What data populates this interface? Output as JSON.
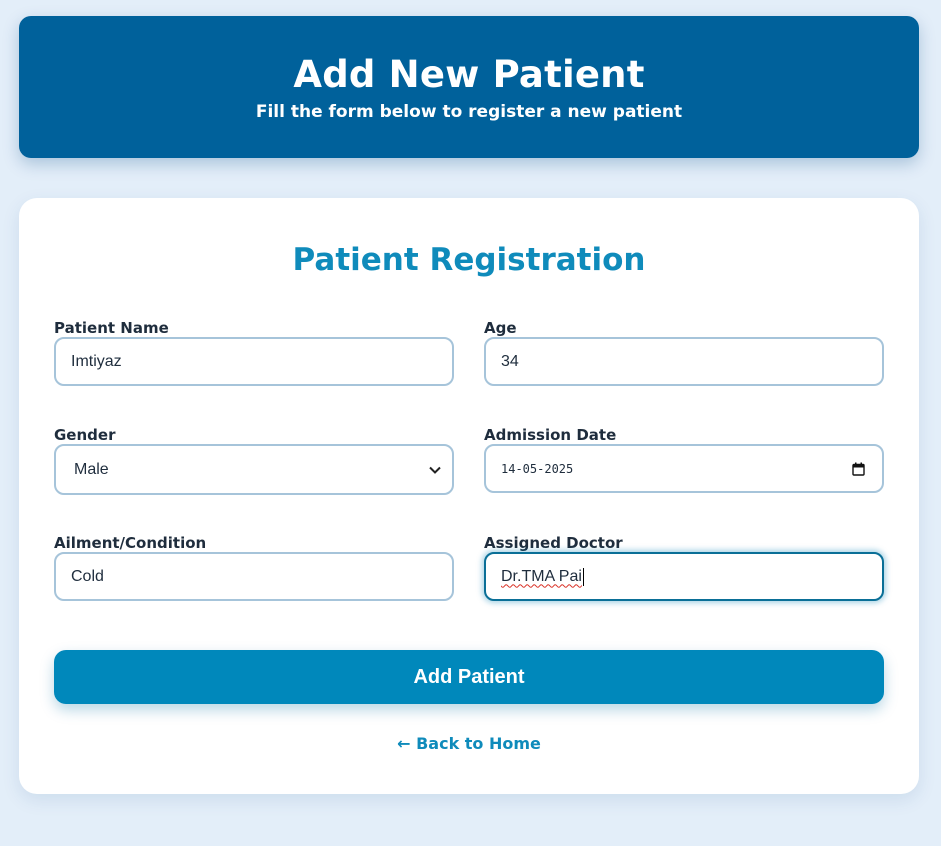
{
  "header": {
    "title": "Add New Patient",
    "subtitle": "Fill the form below to register a new patient"
  },
  "form": {
    "title": "Patient Registration",
    "fields": {
      "patient_name": {
        "label": "Patient Name",
        "value": "Imtiyaz"
      },
      "age": {
        "label": "Age",
        "value": "34"
      },
      "gender": {
        "label": "Gender",
        "value": "Male"
      },
      "admission_date": {
        "label": "Admission Date",
        "value": "14-05-2025"
      },
      "ailment": {
        "label": "Ailment/Condition",
        "value": "Cold"
      },
      "doctor": {
        "label": "Assigned Doctor",
        "value": "Dr.TMA Pai"
      }
    },
    "submit_label": "Add Patient",
    "back_link": "← Back to Home"
  },
  "colors": {
    "header_bg": "#00619b",
    "accent": "#0088bb",
    "page_bg": "#e3eef9"
  }
}
